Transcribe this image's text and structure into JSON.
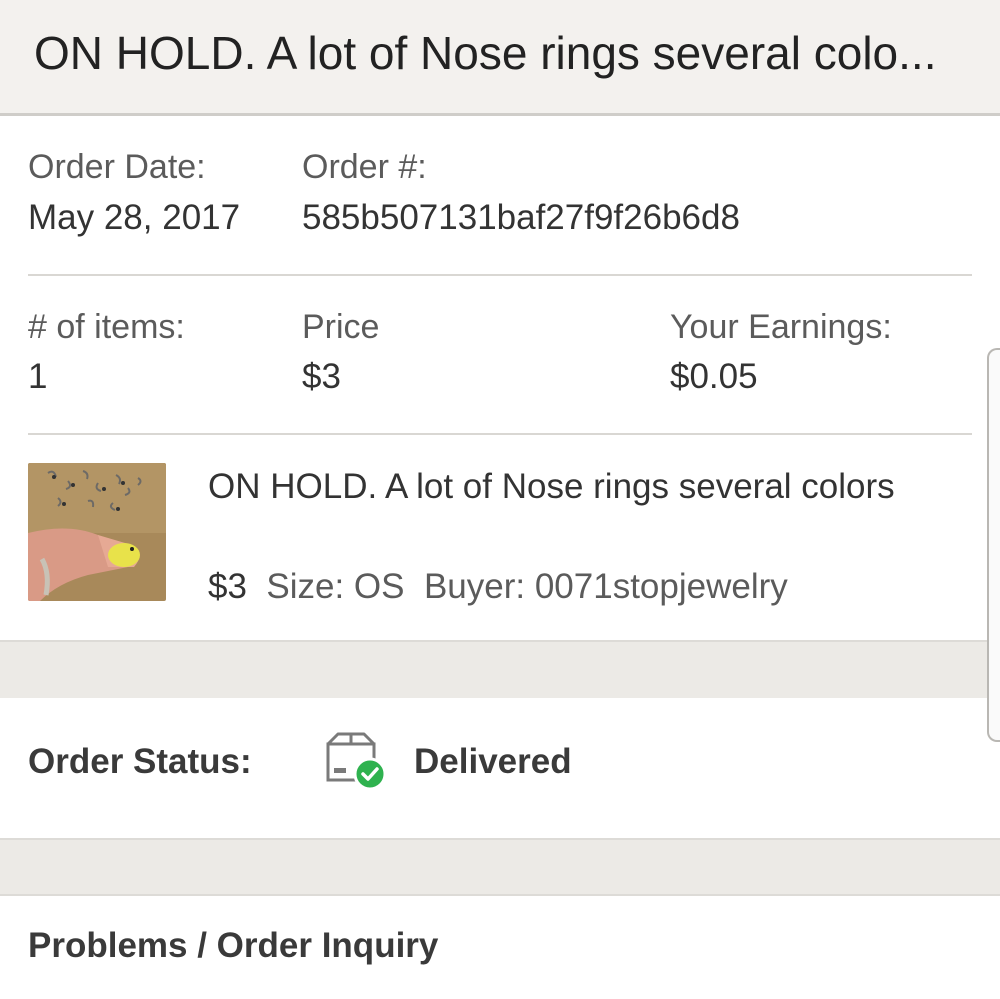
{
  "header": {
    "title": "ON HOLD. A lot of Nose rings several colo..."
  },
  "order": {
    "date_label": "Order Date:",
    "date_value": "May 28, 2017",
    "number_label": "Order #:",
    "number_value": "585b507131baf27f9f26b6d8",
    "items_label": "# of items:",
    "items_value": "1",
    "price_label": "Price",
    "price_value": "$3",
    "earnings_label": "Your Earnings:",
    "earnings_value": "$0.05"
  },
  "product": {
    "image_icon": "product-photo",
    "title": "ON HOLD. A lot of Nose rings several colors",
    "price": "$3",
    "size": "Size: OS",
    "buyer": "Buyer: 0071stopjewelry"
  },
  "status": {
    "label": "Order Status:",
    "icon": "package-delivered-icon",
    "value": "Delivered",
    "check_color": "#2fb24f"
  },
  "problems": {
    "title": "Problems / Order Inquiry"
  }
}
